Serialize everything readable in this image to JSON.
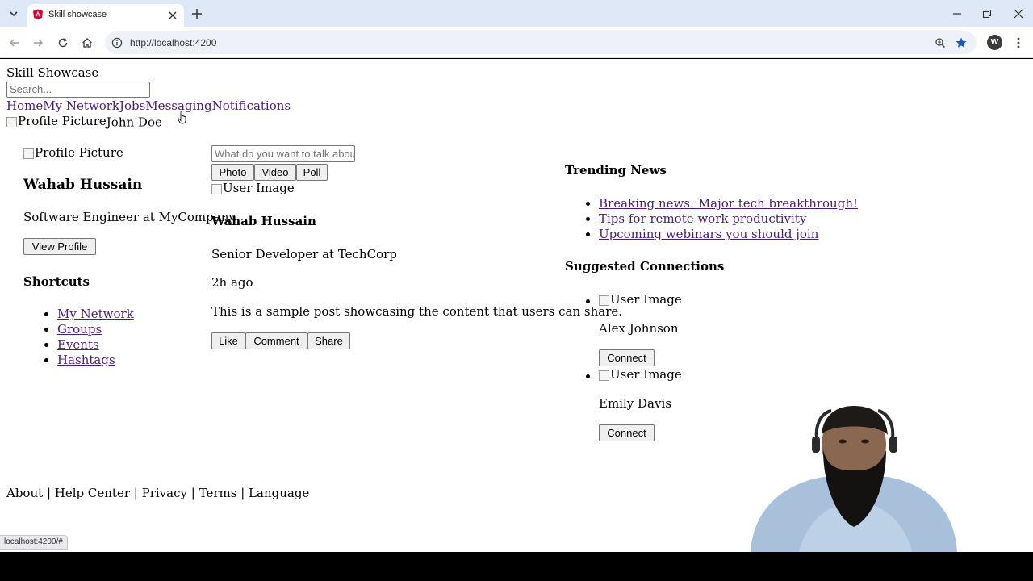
{
  "browser": {
    "tab_title": "Skill showcase",
    "url": "http://localhost:4200",
    "profile_initial": "W",
    "status_url": "localhost:4200/#"
  },
  "page": {
    "brand": "Skill Showcase",
    "search_placeholder": "Search...",
    "nav": [
      "Home",
      "My Network",
      "Jobs",
      "Messaging",
      "Notifications"
    ],
    "header_profile_alt": "Profile Picture",
    "header_user": "John Doe",
    "left": {
      "profile_alt": "Profile Picture",
      "name": "Wahab Hussain",
      "title": "Software Engineer at MyCompany",
      "view_profile": "View Profile",
      "shortcuts_heading": "Shortcuts",
      "shortcuts": [
        "My Network",
        "Groups",
        "Events",
        "Hashtags"
      ]
    },
    "composer": {
      "placeholder": "What do you want to talk about?",
      "buttons": [
        "Photo",
        "Video",
        "Poll"
      ]
    },
    "post": {
      "image_alt": "User Image",
      "author": "Wahab Hussain",
      "author_title": "Senior Developer at TechCorp",
      "time": "2h ago",
      "content": "This is a sample post showcasing the content that users can share.",
      "actions": [
        "Like",
        "Comment",
        "Share"
      ]
    },
    "right": {
      "trending_heading": "Trending News",
      "trending": [
        "Breaking news: Major tech breakthrough!",
        "Tips for remote work productivity",
        "Upcoming webinars you should join"
      ],
      "suggested_heading": "Suggested Connections",
      "suggestions": [
        {
          "image_alt": "User Image",
          "name": "Alex Johnson",
          "button": "Connect"
        },
        {
          "image_alt": "User Image",
          "name": "Emily Davis",
          "button": "Connect"
        }
      ]
    },
    "footer": [
      "About",
      "Help Center",
      "Privacy",
      "Terms",
      "Language"
    ],
    "footer_separator": "|"
  },
  "colors": {
    "tabstrip": "#dfe8f6",
    "link_visited": "#4b1c7a",
    "bookmark_star": "#1a56c8"
  }
}
